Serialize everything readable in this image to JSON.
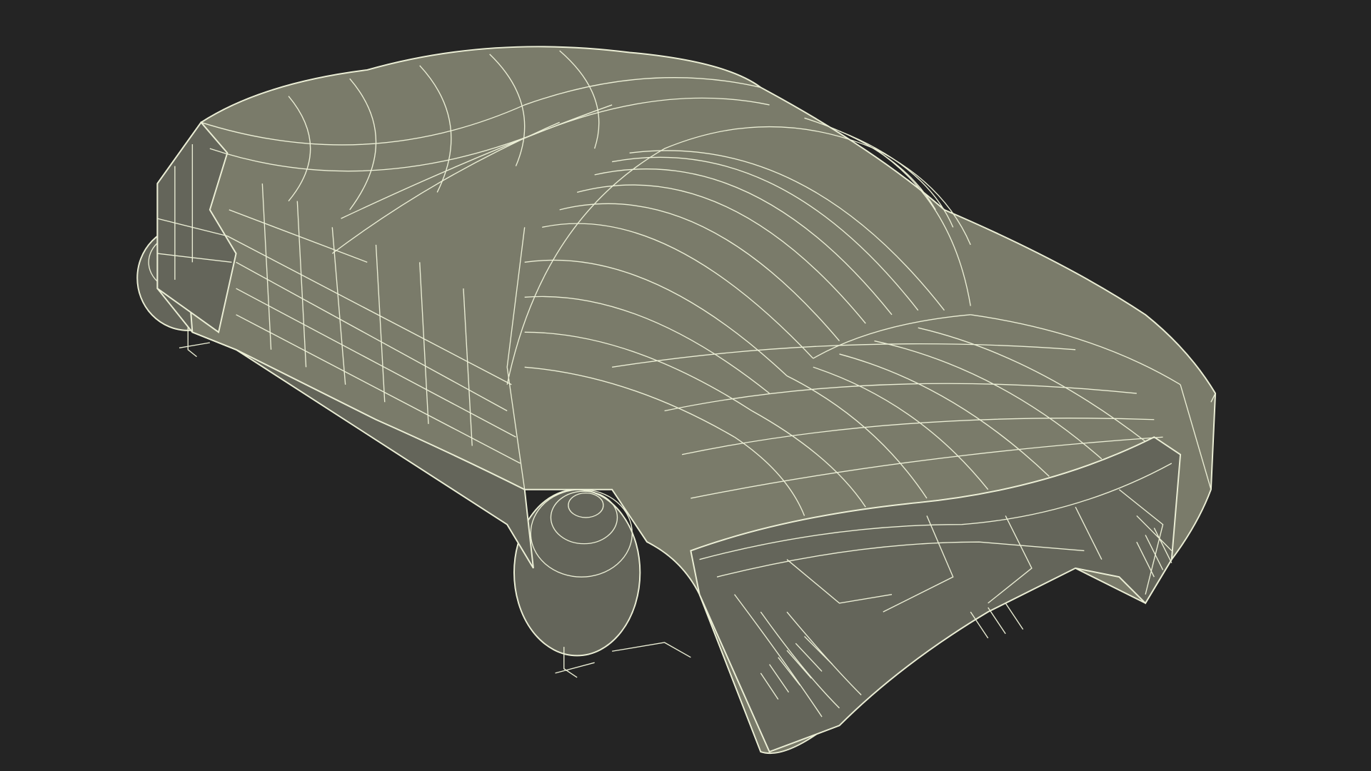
{
  "scene": {
    "subject": "wireframe-render",
    "background_color": "#242424",
    "mesh_fill_color": "#7a7b6a",
    "mesh_shadow_color": "#64655a",
    "wire_color": "#ecefd6"
  }
}
